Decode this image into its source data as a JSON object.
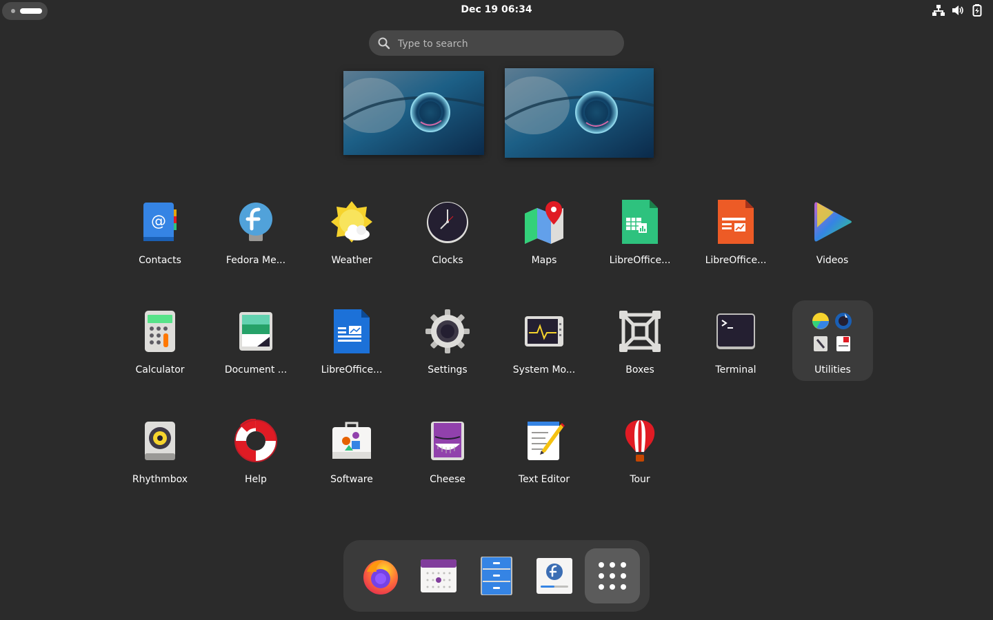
{
  "topbar": {
    "clock": "Dec 19  06:34",
    "tray_icons": [
      "network-icon",
      "volume-icon",
      "battery-icon"
    ]
  },
  "search": {
    "placeholder": "Type to search"
  },
  "workspaces": [
    {
      "name": "workspace-1"
    },
    {
      "name": "workspace-2"
    }
  ],
  "apps": [
    {
      "label": "Contacts"
    },
    {
      "label": "Fedora Me..."
    },
    {
      "label": "Weather"
    },
    {
      "label": "Clocks"
    },
    {
      "label": "Maps"
    },
    {
      "label": "LibreOffice..."
    },
    {
      "label": "LibreOffice..."
    },
    {
      "label": "Videos"
    },
    {
      "label": "Calculator"
    },
    {
      "label": "Document ..."
    },
    {
      "label": "LibreOffice..."
    },
    {
      "label": "Settings"
    },
    {
      "label": "System Mo..."
    },
    {
      "label": "Boxes"
    },
    {
      "label": "Terminal"
    },
    {
      "label": "Utilities"
    },
    {
      "label": "Rhythmbox"
    },
    {
      "label": "Help"
    },
    {
      "label": "Software"
    },
    {
      "label": "Cheese"
    },
    {
      "label": "Text Editor"
    },
    {
      "label": "Tour"
    }
  ],
  "dash": [
    "firefox-icon",
    "calendar-icon",
    "files-icon",
    "fedora-media-writer-icon",
    "show-apps-icon"
  ],
  "colors": {
    "background": "#2b2b2b",
    "panel": "#3a3a3a",
    "search": "#474747",
    "accent": "#3584e4"
  }
}
